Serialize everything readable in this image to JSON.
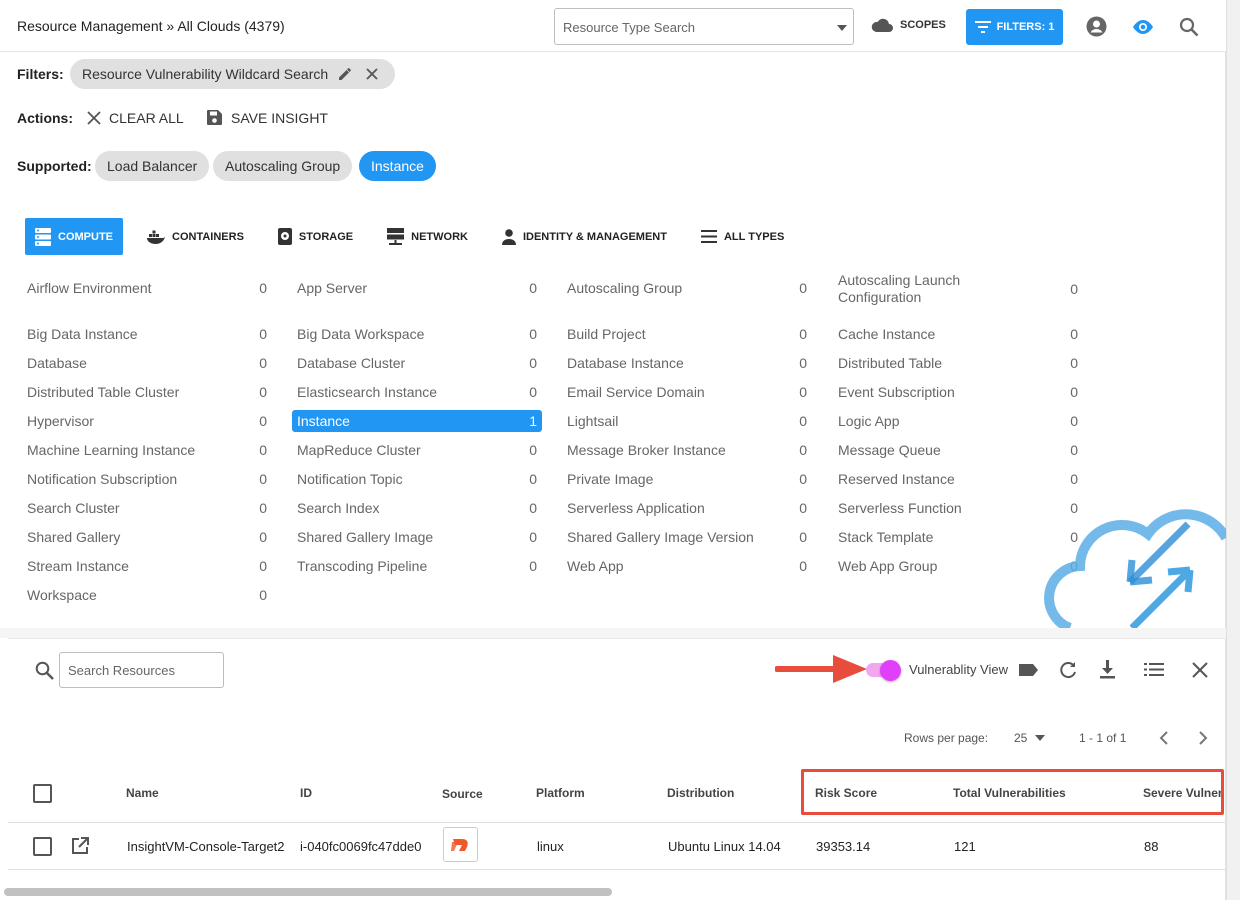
{
  "header": {
    "breadcrumb": "Resource Management » All Clouds (4379)",
    "type_search_placeholder": "Resource Type Search",
    "scopes_label": "SCOPES",
    "filters_label": "FILTERS: 1",
    "icons": [
      "account-circle-icon",
      "eye-icon",
      "search-icon"
    ]
  },
  "filters": {
    "label": "Filters:",
    "chip": "Resource Vulnerability Wildcard Search"
  },
  "actions": {
    "label": "Actions:",
    "clear_all": "CLEAR ALL",
    "save_insight": "SAVE INSIGHT"
  },
  "supported": {
    "label": "Supported:",
    "items": [
      "Load Balancer",
      "Autoscaling Group",
      "Instance"
    ],
    "selected": "Instance"
  },
  "tabs": [
    {
      "label": "COMPUTE",
      "icon": "server-icon",
      "active": true
    },
    {
      "label": "CONTAINERS",
      "icon": "docker-icon",
      "active": false
    },
    {
      "label": "STORAGE",
      "icon": "storage-icon",
      "active": false
    },
    {
      "label": "NETWORK",
      "icon": "network-icon",
      "active": false
    },
    {
      "label": "IDENTITY & MANAGEMENT",
      "icon": "person-icon",
      "active": false
    },
    {
      "label": "ALL TYPES",
      "icon": "list-icon",
      "active": false
    }
  ],
  "resource_types": [
    [
      {
        "label": "Airflow Environment",
        "count": "0"
      },
      {
        "label": "Big Data Instance",
        "count": "0"
      },
      {
        "label": "Database",
        "count": "0"
      },
      {
        "label": "Distributed Table Cluster",
        "count": "0"
      },
      {
        "label": "Hypervisor",
        "count": "0"
      },
      {
        "label": "Machine Learning Instance",
        "count": "0"
      },
      {
        "label": "Notification Subscription",
        "count": "0"
      },
      {
        "label": "Search Cluster",
        "count": "0"
      },
      {
        "label": "Shared Gallery",
        "count": "0"
      },
      {
        "label": "Stream Instance",
        "count": "0"
      },
      {
        "label": "Workspace",
        "count": "0"
      }
    ],
    [
      {
        "label": "App Server",
        "count": "0"
      },
      {
        "label": "Big Data Workspace",
        "count": "0"
      },
      {
        "label": "Database Cluster",
        "count": "0"
      },
      {
        "label": "Elasticsearch Instance",
        "count": "0"
      },
      {
        "label": "Instance",
        "count": "1",
        "selected": true
      },
      {
        "label": "MapReduce Cluster",
        "count": "0"
      },
      {
        "label": "Notification Topic",
        "count": "0"
      },
      {
        "label": "Search Index",
        "count": "0"
      },
      {
        "label": "Shared Gallery Image",
        "count": "0"
      },
      {
        "label": "Transcoding Pipeline",
        "count": "0"
      }
    ],
    [
      {
        "label": "Autoscaling Group",
        "count": "0"
      },
      {
        "label": "Build Project",
        "count": "0"
      },
      {
        "label": "Database Instance",
        "count": "0"
      },
      {
        "label": "Email Service Domain",
        "count": "0"
      },
      {
        "label": "Lightsail",
        "count": "0"
      },
      {
        "label": "Message Broker Instance",
        "count": "0"
      },
      {
        "label": "Private Image",
        "count": "0"
      },
      {
        "label": "Serverless Application",
        "count": "0"
      },
      {
        "label": "Shared Gallery Image Version",
        "count": "0"
      },
      {
        "label": "Web App",
        "count": "0"
      }
    ],
    [
      {
        "label": "Autoscaling Launch Configuration",
        "count": "0"
      },
      {
        "label": "Cache Instance",
        "count": "0"
      },
      {
        "label": "Distributed Table",
        "count": "0"
      },
      {
        "label": "Event Subscription",
        "count": "0"
      },
      {
        "label": "Logic App",
        "count": "0"
      },
      {
        "label": "Message Queue",
        "count": "0"
      },
      {
        "label": "Reserved Instance",
        "count": "0"
      },
      {
        "label": "Serverless Function",
        "count": "0"
      },
      {
        "label": "Stack Template",
        "count": "0"
      },
      {
        "label": "Web App Group",
        "count": "0"
      }
    ]
  ],
  "resources": {
    "search_placeholder": "Search Resources",
    "vuln_view_label": "Vulnerablity View",
    "vuln_view_on": true,
    "rows_per_page_label": "Rows per page:",
    "rows_per_page": "25",
    "range": "1 - 1 of 1",
    "columns": [
      "Name",
      "ID",
      "Source",
      "Platform",
      "Distribution",
      "Risk Score",
      "Total Vulnerabilities",
      "Severe Vulnera"
    ],
    "rows": [
      {
        "name": "InsightVM-Console-Target2",
        "id": "i-040fc0069fc47dde0",
        "source_icon": "insightvm-logo-icon",
        "platform": "linux",
        "distribution": "Ubuntu Linux 14.04",
        "risk_score": "39353.14",
        "total_vulnerabilities": "121",
        "severe_vulnerabilities": "88"
      }
    ]
  },
  "colors": {
    "accent": "#2196f3",
    "toggle": "#e040fb",
    "annotation": "#e74c3c"
  }
}
